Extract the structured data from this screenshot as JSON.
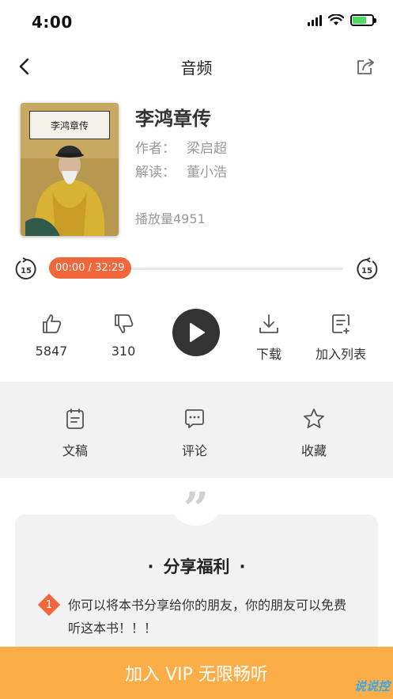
{
  "status_bar": {
    "time": "4:00"
  },
  "nav": {
    "title": "音频"
  },
  "book": {
    "cover_label": "李鸿章传",
    "title": "李鸿章传",
    "author_label": "作者：",
    "author": "梁启超",
    "reader_label": "解读：",
    "reader": "董小浩",
    "play_count": "播放量4951"
  },
  "player": {
    "position_text": "00:00 / 32:29",
    "progress_fraction": 0.0,
    "skip_seconds": "15"
  },
  "actions": {
    "like_count": "5847",
    "dislike_count": "310",
    "download_label": "下载",
    "playlist_label": "加入列表"
  },
  "secondary": {
    "script_label": "文稿",
    "comment_label": "评论",
    "favorite_label": "收藏"
  },
  "share": {
    "heading": "分享福利",
    "item_number": "1",
    "item_text": "你可以将本书分享给你的朋友，你的朋友可以免费听这本书！！！"
  },
  "vip": {
    "button_label": "加入 VIP 无限畅听"
  },
  "watermark": "说说控",
  "colors": {
    "accent": "#f2663b",
    "vip": "#fbae48",
    "battery": "#4cd964",
    "watermark": "#37a9e9"
  }
}
